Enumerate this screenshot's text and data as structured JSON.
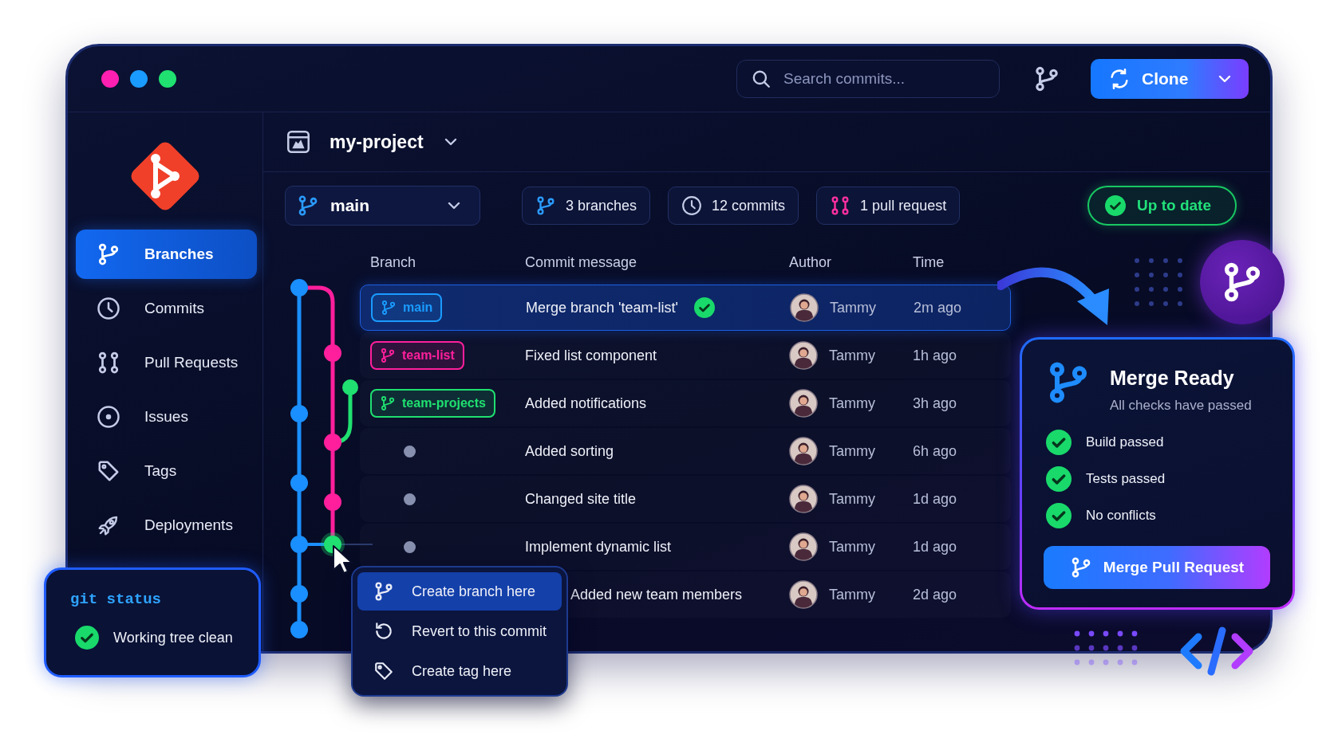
{
  "window": {
    "controls": [
      {
        "color": "#ff1fb0"
      },
      {
        "color": "#1a9bff"
      },
      {
        "color": "#1fe070"
      }
    ]
  },
  "search": {
    "placeholder": "Search commits..."
  },
  "clone_button": {
    "label": "Clone"
  },
  "sidebar": {
    "items": [
      {
        "label": "Branches",
        "selected": true
      },
      {
        "label": "Commits",
        "selected": false
      },
      {
        "label": "Pull Requests",
        "selected": false
      },
      {
        "label": "Issues",
        "selected": false
      },
      {
        "label": "Tags",
        "selected": false
      },
      {
        "label": "Deployments",
        "selected": false
      }
    ]
  },
  "project": {
    "name": "my-project"
  },
  "branch_select": {
    "value": "main"
  },
  "stats": [
    {
      "kind": "branches",
      "label": "3 branches"
    },
    {
      "kind": "commits",
      "label": "12 commits"
    },
    {
      "kind": "pull-requests",
      "label": "1 pull request"
    }
  ],
  "sync_status": {
    "label": "Up to date"
  },
  "table": {
    "columns": [
      "Branch",
      "Commit message",
      "Author",
      "Time"
    ],
    "rows": [
      {
        "branch": {
          "label": "main",
          "color": "#1a9bff"
        },
        "message": "Merge branch 'team-list'",
        "verified": true,
        "author": "Tammy",
        "time": "2m ago",
        "selected": true
      },
      {
        "branch": {
          "label": "team-list",
          "color": "#ff1f9c"
        },
        "message": "Fixed list component",
        "verified": false,
        "author": "Tammy",
        "time": "1h ago",
        "selected": false
      },
      {
        "branch": {
          "label": "team-projects",
          "color": "#1fe070"
        },
        "message": "Added notifications",
        "verified": false,
        "author": "Tammy",
        "time": "3h ago",
        "selected": false
      },
      {
        "message": "Added sorting",
        "verified": false,
        "author": "Tammy",
        "time": "6h ago",
        "selected": false
      },
      {
        "message": "Changed site title",
        "verified": false,
        "author": "Tammy",
        "time": "1d ago",
        "selected": false
      },
      {
        "message": "Implement dynamic list",
        "verified": false,
        "author": "Tammy",
        "time": "1d ago",
        "selected": false
      },
      {
        "message": "Added new team members",
        "verified": false,
        "author": "Tammy",
        "time": "2d ago",
        "selected": false
      }
    ]
  },
  "context_menu": {
    "items": [
      {
        "label": "Create branch here",
        "selected": true
      },
      {
        "label": "Revert to this commit",
        "selected": false
      },
      {
        "label": "Create tag here",
        "selected": false
      }
    ]
  },
  "git_status": {
    "title": "git status",
    "message": "Working tree clean"
  },
  "merge_card": {
    "title": "Merge Ready",
    "subtitle": "All checks have passed",
    "checks": [
      {
        "label": "Build passed",
        "passed": true
      },
      {
        "label": "Tests passed",
        "passed": true
      },
      {
        "label": "No conflicts",
        "passed": true
      }
    ],
    "button": "Merge Pull Request"
  }
}
